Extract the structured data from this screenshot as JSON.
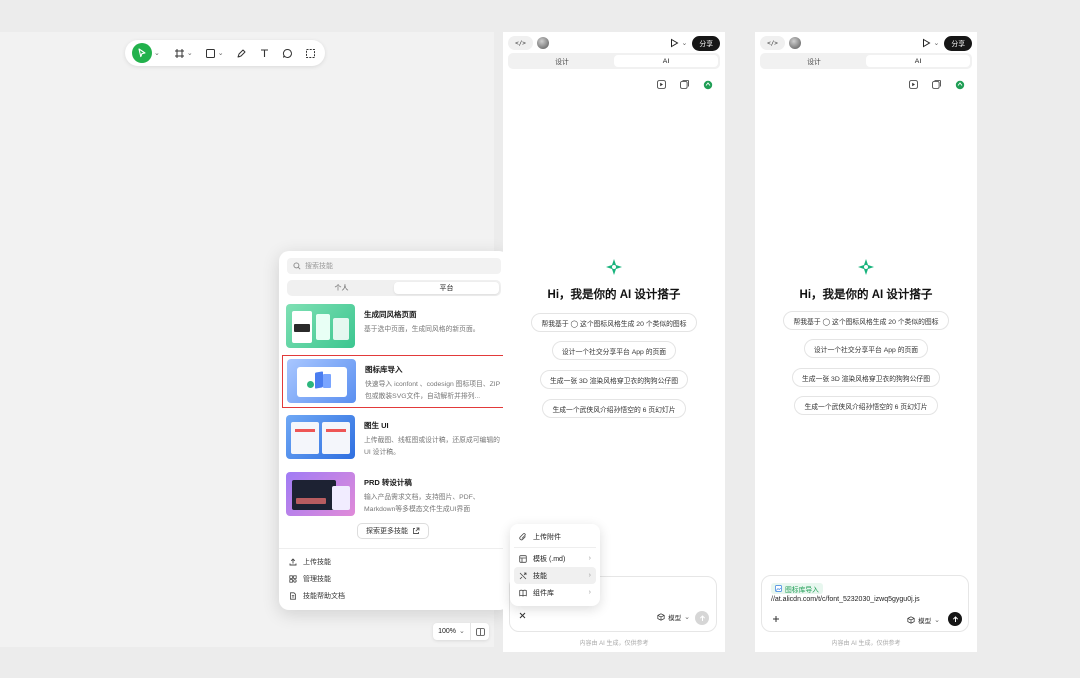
{
  "toolbar": {
    "tools": [
      "move-tool",
      "frame-tool",
      "shape-tool",
      "pen-tool",
      "text-tool",
      "comment-tool",
      "slice-tool"
    ]
  },
  "skills_popup": {
    "search_placeholder": "搜索技能",
    "tabs": [
      {
        "label": "个人",
        "active": false
      },
      {
        "label": "平台",
        "active": true
      }
    ],
    "skills": [
      {
        "name": "生成同风格页面",
        "desc": "基于选中页面，生成同风格的新页面。"
      },
      {
        "name": "图标库导入",
        "desc": "快速导入 iconfont 、codesign 图标项目、ZIP 包或散装SVG文件，自动解析并排列...",
        "selected": true
      },
      {
        "name": "图生 UI",
        "desc": "上传截图、线框图或设计稿，还原成可编辑的 UI 设计稿。"
      },
      {
        "name": "PRD 转设计稿",
        "desc": "输入产品需求文档，支持图片、PDF、Markdown等多模态文件生成UI界面"
      }
    ],
    "more_label": "探索更多技能",
    "links": [
      "上传技能",
      "管理技能",
      "技能帮助文档"
    ]
  },
  "zoom": {
    "value": "100%"
  },
  "panel1": {
    "share_label": "分享",
    "tabs": [
      {
        "label": "设计",
        "active": false
      },
      {
        "label": "AI",
        "active": true
      }
    ],
    "greeting": "Hi，我是你的 AI 设计搭子",
    "suggestions": [
      "帮我基于 ◯ 这个图标风格生成 20 个类似的图标",
      "设计一个社交分享平台 App 的页面",
      "生成一张 3D 渲染风格穿卫衣的狗狗公仔图",
      "生成一个武侠风介绍孙悟空的 6 页幻灯片"
    ],
    "model_label": "模型",
    "footnote": "内容由 AI 生成，仅供参考"
  },
  "attach_menu": {
    "items": [
      {
        "label": "上传附件",
        "icon": "paperclip-icon",
        "has_arrow": false
      },
      {
        "label": "模板 (.md)",
        "icon": "template-icon",
        "has_arrow": true
      },
      {
        "label": "技能",
        "icon": "skill-icon",
        "has_arrow": true,
        "highlighted": true
      },
      {
        "label": "组件库",
        "icon": "library-icon",
        "has_arrow": true
      }
    ]
  },
  "panel2": {
    "share_label": "分享",
    "tabs": [
      {
        "label": "设计",
        "active": false
      },
      {
        "label": "AI",
        "active": true
      }
    ],
    "greeting": "Hi，我是你的 AI 设计搭子",
    "suggestions": [
      "帮我基于 ◯ 这个图标风格生成 20 个类似的图标",
      "设计一个社交分享平台 App 的页面",
      "生成一张 3D 渲染风格穿卫衣的狗狗公仔图",
      "生成一个武侠风介绍孙悟空的 6 页幻灯片"
    ],
    "skill_tag": "图标库导入",
    "input_value": "//at.alicdn.com/t/c/font_5232030_izwq5gygu0j.js",
    "model_label": "模型",
    "footnote": "内容由 AI 生成，仅供参考"
  },
  "colors": {
    "accent_green": "#22b14c",
    "selection_red": "#e23a3a",
    "dark": "#161616"
  }
}
